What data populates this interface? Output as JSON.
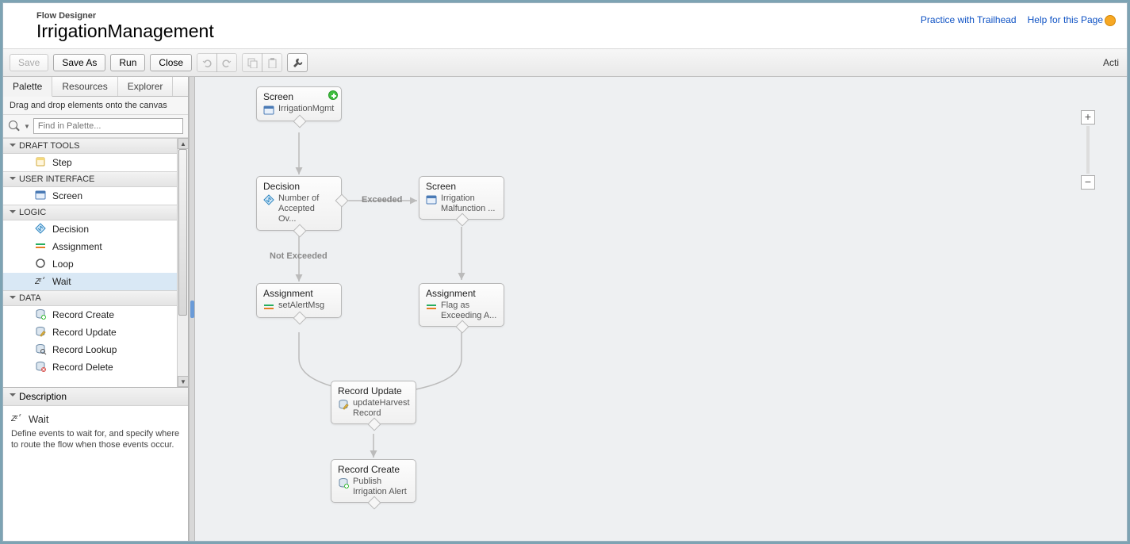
{
  "header": {
    "app_name": "Flow Designer",
    "flow_name": "IrrigationManagement",
    "links": {
      "trailhead": "Practice with Trailhead",
      "help": "Help for this Page"
    }
  },
  "toolbar": {
    "save": "Save",
    "save_as": "Save As",
    "run": "Run",
    "close": "Close",
    "activate": "Acti"
  },
  "sidebar": {
    "tabs": {
      "palette": "Palette",
      "resources": "Resources",
      "explorer": "Explorer"
    },
    "hint": "Drag and drop elements onto the canvas",
    "search_placeholder": "Find in Palette...",
    "categories": [
      {
        "name": "DRAFT TOOLS",
        "items": [
          {
            "label": "Step",
            "icon": "step"
          }
        ]
      },
      {
        "name": "USER INTERFACE",
        "items": [
          {
            "label": "Screen",
            "icon": "screen"
          }
        ]
      },
      {
        "name": "LOGIC",
        "items": [
          {
            "label": "Decision",
            "icon": "decision"
          },
          {
            "label": "Assignment",
            "icon": "assignment"
          },
          {
            "label": "Loop",
            "icon": "loop"
          },
          {
            "label": "Wait",
            "icon": "wait",
            "selected": true
          }
        ]
      },
      {
        "name": "DATA",
        "items": [
          {
            "label": "Record Create",
            "icon": "rcreate"
          },
          {
            "label": "Record Update",
            "icon": "rupdate"
          },
          {
            "label": "Record Lookup",
            "icon": "rlookup"
          },
          {
            "label": "Record Delete",
            "icon": "rdelete"
          }
        ]
      }
    ],
    "description": {
      "header": "Description",
      "title": "Wait",
      "icon": "wait",
      "text": "Define events to wait for, and specify where to route the flow when those events occur."
    }
  },
  "canvas": {
    "nodes": {
      "n1": {
        "type": "Screen",
        "label": "IrrigationMgmt",
        "icon": "screen"
      },
      "n2": {
        "type": "Decision",
        "label": "Number of Accepted Ov...",
        "icon": "decision"
      },
      "n3": {
        "type": "Screen",
        "label": "Irrigation Malfunction ...",
        "icon": "screen"
      },
      "n4": {
        "type": "Assignment",
        "label": "setAlertMsg",
        "icon": "assignment"
      },
      "n5": {
        "type": "Assignment",
        "label": "Flag as Exceeding A...",
        "icon": "assignment"
      },
      "n6": {
        "type": "Record Update",
        "label": "updateHarvest Record",
        "icon": "rupdate"
      },
      "n7": {
        "type": "Record Create",
        "label": "Publish Irrigation Alert",
        "icon": "rcreate"
      }
    },
    "edge_labels": {
      "exceeded": "Exceeded",
      "not_exceeded": "Not Exceeded"
    }
  }
}
